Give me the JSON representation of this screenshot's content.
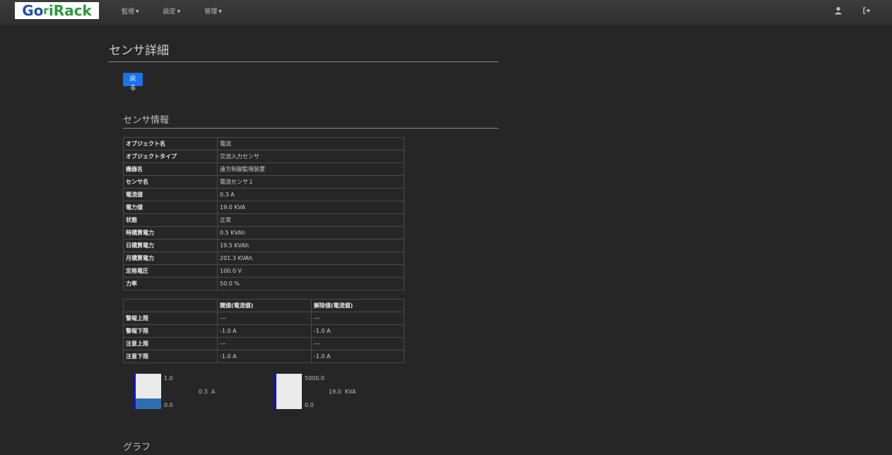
{
  "brand": {
    "logo_text_a": "Go",
    "logo_text_b": "r",
    "logo_text_c": "iRack"
  },
  "nav": {
    "menus": [
      {
        "label": "監視"
      },
      {
        "label": "設定"
      },
      {
        "label": "管理"
      }
    ],
    "user_icon": "user-icon",
    "logout_icon": "logout-icon"
  },
  "page": {
    "title": "センサ詳細",
    "back_label": "戻る"
  },
  "sensor_info": {
    "heading": "センサ情報",
    "rows": [
      {
        "key": "オブジェクト名",
        "value": "電流"
      },
      {
        "key": "オブジェクトタイプ",
        "value": "交流入力センサ"
      },
      {
        "key": "機器名",
        "value": "遠方制御監視装置"
      },
      {
        "key": "センサ名",
        "value": "電流センサ１"
      },
      {
        "key": "電流値",
        "value": "0.3 A"
      },
      {
        "key": "電力値",
        "value": "19.0 KVA"
      },
      {
        "key": "状態",
        "value": "正常"
      },
      {
        "key": "時積算電力",
        "value": "0.5 KVAh"
      },
      {
        "key": "日積算電力",
        "value": "19.5 KVAh"
      },
      {
        "key": "月積算電力",
        "value": "201.3 KVAh"
      },
      {
        "key": "定格電圧",
        "value": "100.0 V"
      },
      {
        "key": "力率",
        "value": "50.0 %"
      }
    ]
  },
  "thresholds": {
    "headers": [
      "",
      "閾値(電流値)",
      "解除値(電流値)"
    ],
    "rows": [
      {
        "key": "警報上限",
        "threshold": "---",
        "release": "---"
      },
      {
        "key": "警報下限",
        "threshold": "-1.0 A",
        "release": "-1.0 A"
      },
      {
        "key": "注意上限",
        "threshold": "---",
        "release": "---"
      },
      {
        "key": "注意下限",
        "threshold": "-1.0 A",
        "release": "-1.0 A"
      }
    ]
  },
  "gauges": [
    {
      "max": "1.0",
      "min": "0.0",
      "value_text": "0.3",
      "unit": "A",
      "fill_fraction": 0.3
    },
    {
      "max": "5000.0",
      "min": "0.0",
      "value_text": "19.0",
      "unit": "KVA",
      "fill_fraction": 0.0038
    }
  ],
  "graph": {
    "heading": "グラフ"
  },
  "colors": {
    "accent": "#1a73e8",
    "gauge_fill": "#2f6fb0",
    "gauge_edge": "#1212c8"
  }
}
